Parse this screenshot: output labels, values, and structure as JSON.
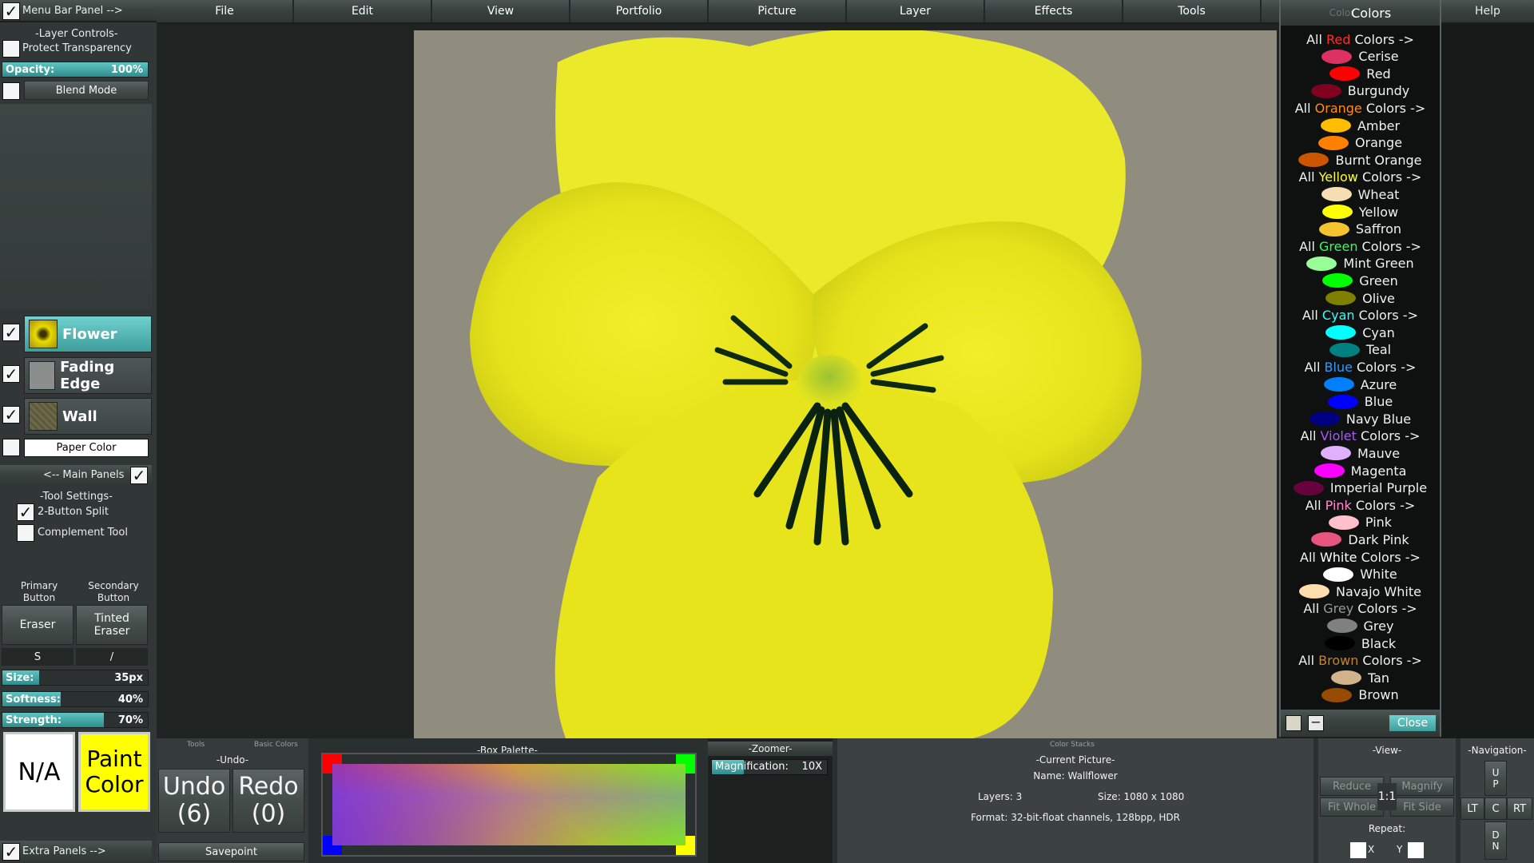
{
  "menubar": {
    "panel_toggle_label": "Menu Bar Panel -->",
    "items": [
      "File",
      "Edit",
      "View",
      "Portfolio",
      "Picture",
      "Layer",
      "Effects",
      "Tools",
      "Help"
    ]
  },
  "layer_controls": {
    "heading": "-Layer Controls-",
    "protect_transparency": "Protect Transparency",
    "opacity_label": "Opacity:",
    "opacity_value": "100%",
    "opacity_fraction": 1.0,
    "blend_mode": "Blend Mode",
    "layers": [
      {
        "name": "Flower",
        "checked": true,
        "active": true
      },
      {
        "name": "Fading Edge",
        "checked": true,
        "active": false
      },
      {
        "name": "Wall",
        "checked": true,
        "active": false
      }
    ],
    "paper_color": "Paper Color",
    "main_panels": "<-- Main Panels"
  },
  "tool_settings": {
    "heading": "-Tool Settings-",
    "two_button_split": "2-Button Split",
    "complement_tool": "Complement Tool",
    "primary_label": "Primary Button",
    "secondary_label": "Secondary Button",
    "primary_tool": "Eraser",
    "secondary_tool": "Tinted Eraser",
    "primary_key": "S",
    "secondary_key": "/",
    "sliders": [
      {
        "name": "Size:",
        "value": "35px",
        "fraction": 0.25
      },
      {
        "name": "Softness:",
        "value": "40%",
        "fraction": 0.4
      },
      {
        "name": "Strength:",
        "value": "70%",
        "fraction": 0.7
      }
    ],
    "na_label": "N/A",
    "paint_color_label": "Paint Color",
    "extra_panels": "Extra Panels -->"
  },
  "colors_panel": {
    "title_ghost": "Color",
    "title": "Colors",
    "close": "Close",
    "groups": [
      {
        "prefix": "All ",
        "word": "Red",
        "suffix": " Colors ->",
        "accent": "#ff2a2a",
        "items": [
          {
            "name": "Cerise",
            "color": "#de3163"
          },
          {
            "name": "Red",
            "color": "#ff0000"
          },
          {
            "name": "Burgundy",
            "color": "#800020"
          }
        ]
      },
      {
        "prefix": "All ",
        "word": "Orange",
        "suffix": " Colors ->",
        "accent": "#ff8c1a",
        "items": [
          {
            "name": "Amber",
            "color": "#ffbf00"
          },
          {
            "name": "Orange",
            "color": "#ff7f00"
          },
          {
            "name": "Burnt Orange",
            "color": "#cc5500"
          }
        ]
      },
      {
        "prefix": "All ",
        "word": "Yellow",
        "suffix": " Colors ->",
        "accent": "#ffff33",
        "items": [
          {
            "name": "Wheat",
            "color": "#f5deb3"
          },
          {
            "name": "Yellow",
            "color": "#ffff00"
          },
          {
            "name": "Saffron",
            "color": "#f4c430"
          }
        ]
      },
      {
        "prefix": "All ",
        "word": "Green",
        "suffix": " Colors ->",
        "accent": "#33ff55",
        "items": [
          {
            "name": "Mint Green",
            "color": "#98ff98"
          },
          {
            "name": "Green",
            "color": "#00ff00"
          },
          {
            "name": "Olive",
            "color": "#808000"
          }
        ]
      },
      {
        "prefix": "All ",
        "word": "Cyan",
        "suffix": " Colors ->",
        "accent": "#33ffff",
        "items": [
          {
            "name": "Cyan",
            "color": "#00ffff"
          },
          {
            "name": "Teal",
            "color": "#008080"
          }
        ]
      },
      {
        "prefix": "All ",
        "word": "Blue",
        "suffix": " Colors ->",
        "accent": "#3399ff",
        "items": [
          {
            "name": "Azure",
            "color": "#007fff"
          },
          {
            "name": "Blue",
            "color": "#0000ff"
          },
          {
            "name": "Navy Blue",
            "color": "#000080"
          }
        ]
      },
      {
        "prefix": "All ",
        "word": "Violet",
        "suffix": " Colors ->",
        "accent": "#aa55ff",
        "items": [
          {
            "name": "Mauve",
            "color": "#e0b0ff"
          },
          {
            "name": "Magenta",
            "color": "#ff00ff"
          },
          {
            "name": "Imperial Purple",
            "color": "#66023c"
          }
        ]
      },
      {
        "prefix": "All ",
        "word": "Pink",
        "suffix": " Colors ->",
        "accent": "#ff88cc",
        "items": [
          {
            "name": "Pink",
            "color": "#ffc0cb"
          },
          {
            "name": "Dark Pink",
            "color": "#e75480"
          }
        ]
      },
      {
        "prefix": "All ",
        "word": "White",
        "suffix": " Colors ->",
        "accent": "#ffffff",
        "items": [
          {
            "name": "White",
            "color": "#ffffff"
          },
          {
            "name": "Navajo White",
            "color": "#ffdead"
          }
        ]
      },
      {
        "prefix": "All ",
        "word": "Grey",
        "suffix": " Colors ->",
        "accent": "#9a9a9a",
        "items": [
          {
            "name": "Grey",
            "color": "#808080"
          },
          {
            "name": "Black",
            "color": "#000000"
          }
        ]
      },
      {
        "prefix": "All ",
        "word": "Brown",
        "suffix": " Colors ->",
        "accent": "#c8822a",
        "items": [
          {
            "name": "Tan",
            "color": "#d2b48c"
          },
          {
            "name": "Brown",
            "color": "#964b00"
          }
        ]
      }
    ]
  },
  "bottom": {
    "tools_tab": "Tools",
    "basic_colors_tab": "Basic Colors",
    "undo_heading": "-Undo-",
    "undo": "Undo",
    "undo_count": "(6)",
    "redo": "Redo",
    "redo_count": "(0)",
    "savepoint": "Savepoint",
    "box_palette": "-Box Palette-",
    "zoomer": "-Zoomer-",
    "magnification_label": "Magnification:",
    "magnification_value": "10X",
    "color_stacks_tab": "Color Stacks",
    "current_picture": "-Current Picture-",
    "name_line": "Name: Wallflower",
    "layers_line": "Layers: 3",
    "size_line": "Size: 1080 x 1080",
    "format_line": "Format: 32-bit-float channels, 128bpp, HDR",
    "view_heading": "-View-",
    "reduce": "Reduce",
    "magnify": "Magnify",
    "one_to_one": "1:1",
    "fit_whole": "Fit Whole",
    "fit_side": "Fit Side",
    "repeat": "Repeat:",
    "repeat_x": "X",
    "repeat_y": "Y",
    "nav_heading": "-Navigation-",
    "nav_up": "UP",
    "nav_lt": "LT",
    "nav_c": "C",
    "nav_rt": "RT",
    "nav_dn": "DN"
  },
  "accents": {
    "teal": "#4fb8b6",
    "paint_color": "#ffff00"
  }
}
